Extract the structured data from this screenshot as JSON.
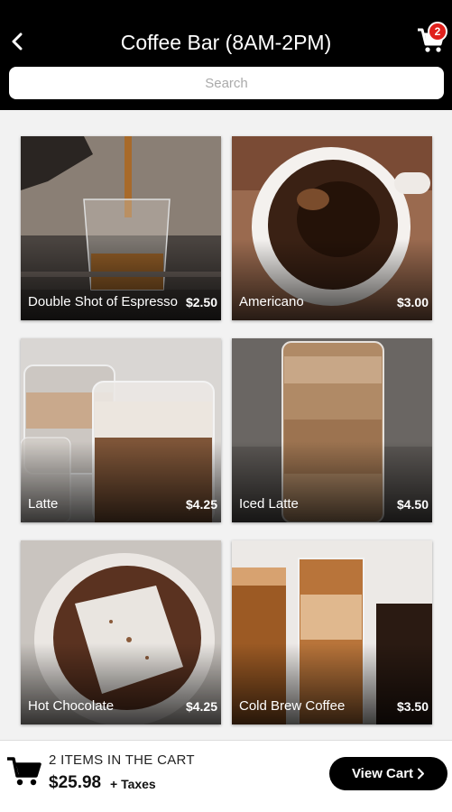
{
  "header": {
    "title": "Coffee Bar (8AM-2PM)",
    "back_icon": "chevron-left-icon",
    "cart_icon": "cart-icon",
    "cart_badge": "2"
  },
  "search": {
    "placeholder": "Search",
    "value": ""
  },
  "products": [
    {
      "name": "Double Shot of Espresso",
      "price": "$2.50"
    },
    {
      "name": "Americano",
      "price": "$3.00"
    },
    {
      "name": "Latte",
      "price": "$4.25"
    },
    {
      "name": "Iced Latte",
      "price": "$4.50"
    },
    {
      "name": "Hot Chocolate",
      "price": "$4.25"
    },
    {
      "name": "Cold Brew Coffee",
      "price": "$3.50"
    }
  ],
  "footer": {
    "items_in_cart": "2 ITEMS IN THE CART",
    "total": "$25.98",
    "taxes": "+ Taxes",
    "view_cart_label": "View Cart"
  },
  "colors": {
    "header_bg": "#000000",
    "badge": "#e0201c",
    "button_bg": "#000000"
  }
}
